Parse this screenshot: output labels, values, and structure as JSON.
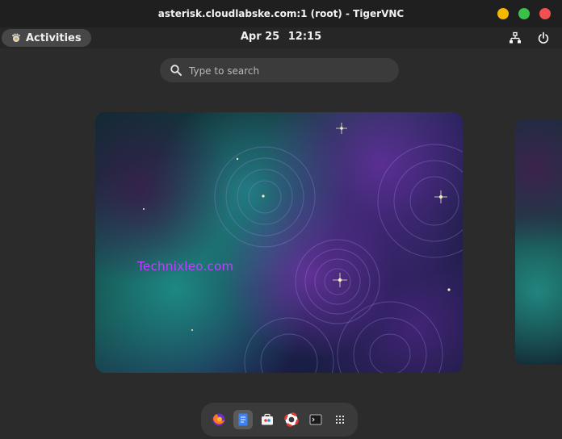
{
  "window": {
    "title": "asterisk.cloudlabske.com:1 (root) - TigerVNC",
    "buttons": {
      "minimize_color": "#f5b800",
      "maximize_color": "#39c14a",
      "close_color": "#f25050"
    }
  },
  "topbar": {
    "activities_label": "Activities",
    "date": "Apr 25",
    "time": "12:15",
    "tray": [
      "network-icon",
      "power-icon"
    ]
  },
  "search": {
    "placeholder": "Type to search",
    "value": ""
  },
  "workspace": {
    "watermark": "Technixleo.com"
  },
  "dash": {
    "apps": [
      {
        "name": "firefox-icon",
        "active": false
      },
      {
        "name": "text-editor-icon",
        "active": true
      },
      {
        "name": "software-icon",
        "active": false
      },
      {
        "name": "help-icon",
        "active": false
      },
      {
        "name": "terminal-icon",
        "active": false
      },
      {
        "name": "app-grid-icon",
        "active": false
      }
    ]
  },
  "colors": {
    "accent_blue": "#3b82f6",
    "watermark": "#c040ff"
  }
}
